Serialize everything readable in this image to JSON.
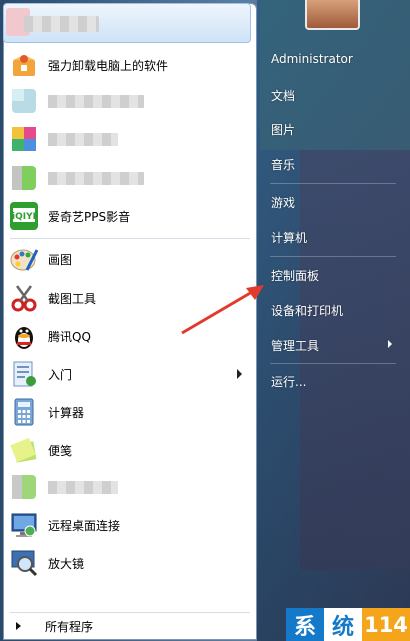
{
  "left_panel": {
    "user_display_name": "",
    "pinned": [
      {
        "name": "program-uninstaller",
        "label": "强力卸载电脑上的软件",
        "icon": "uninstall-box-icon"
      }
    ],
    "items": [
      {
        "name": "blurred-program-1",
        "label": "",
        "icon": "blurred-icon"
      },
      {
        "name": "blurred-program-2",
        "label": "",
        "icon": "blurred-icon"
      },
      {
        "name": "blurred-program-3",
        "label": "",
        "icon": "blurred-icon"
      },
      {
        "name": "iqiyi",
        "label": "爱奇艺PPS影音",
        "icon": "iqiyi-icon"
      },
      {
        "name": "paint",
        "label": "画图",
        "icon": "paint-palette-icon"
      },
      {
        "name": "snipping-tool",
        "label": "截图工具",
        "icon": "scissors-icon"
      },
      {
        "name": "tencent-qq",
        "label": "腾讯QQ",
        "icon": "qq-penguin-icon"
      },
      {
        "name": "getting-started",
        "label": "入门",
        "icon": "getting-started-icon",
        "has_submenu": true
      },
      {
        "name": "calculator",
        "label": "计算器",
        "icon": "calculator-icon"
      },
      {
        "name": "sticky-notes",
        "label": "便笺",
        "icon": "sticky-note-icon"
      },
      {
        "name": "blurred-program-4",
        "label": "",
        "icon": "blurred-icon"
      },
      {
        "name": "remote-desktop",
        "label": "远程桌面连接",
        "icon": "remote-desktop-icon"
      },
      {
        "name": "magnifier",
        "label": "放大镜",
        "icon": "magnifier-icon"
      }
    ],
    "all_programs": "所有程序"
  },
  "right_panel": {
    "items": [
      {
        "name": "administrator",
        "label": "Administrator"
      },
      {
        "name": "documents",
        "label": "文档"
      },
      {
        "name": "pictures",
        "label": "图片"
      },
      {
        "name": "music",
        "label": "音乐"
      },
      {
        "name": "games",
        "label": "游戏"
      },
      {
        "name": "computer",
        "label": "计算机"
      },
      {
        "name": "control-panel",
        "label": "控制面板"
      },
      {
        "name": "devices-printers",
        "label": "设备和打印机"
      },
      {
        "name": "admin-tools",
        "label": "管理工具",
        "has_submenu": true
      },
      {
        "name": "run",
        "label": "运行..."
      }
    ]
  },
  "watermark": {
    "chars": [
      "系",
      "统",
      "114"
    ]
  },
  "colors": {
    "annotation_arrow": "#e23b2e",
    "link_blue": "#1479c9"
  }
}
